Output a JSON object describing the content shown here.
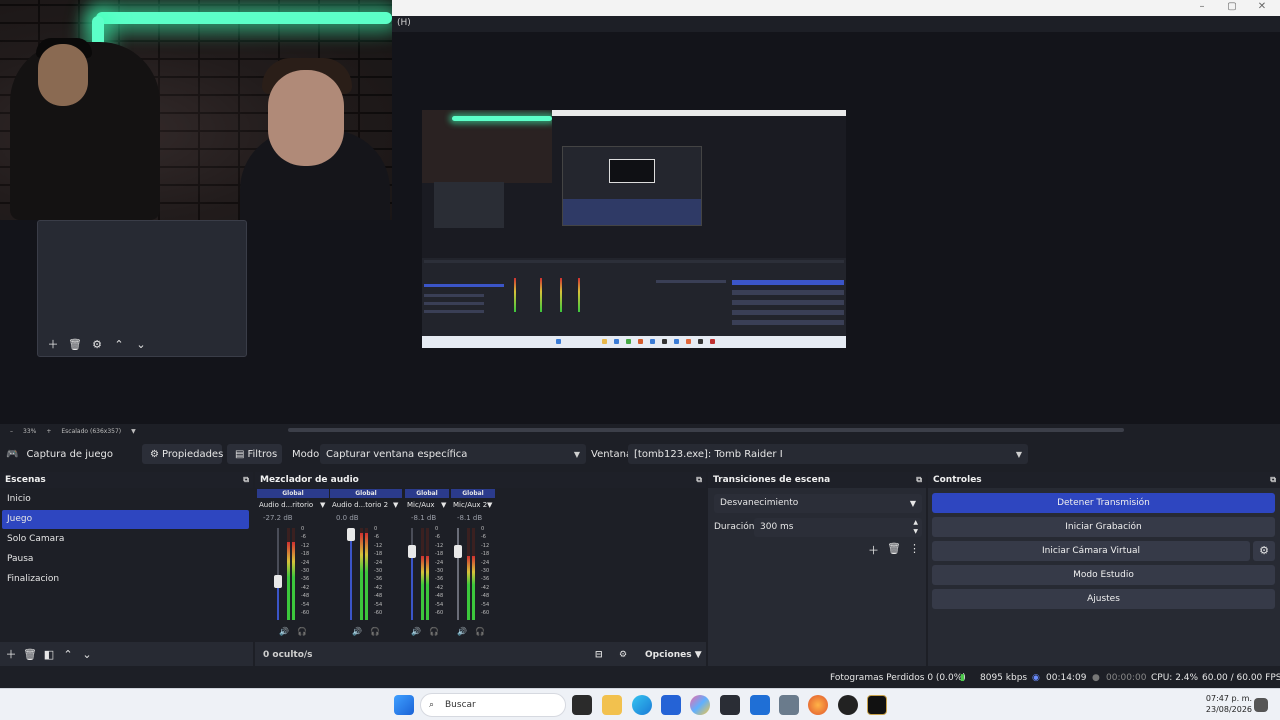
{
  "window": {
    "menu_help": "(H)",
    "minimize": "–",
    "maximize": "▢",
    "close": "✕"
  },
  "preview": {
    "zoom": "33%",
    "scale_label": "Escalado (636x357)",
    "zoom_minus": "–",
    "zoom_plus": "+"
  },
  "source_toolbar": {
    "source_name": "Captura de juego",
    "properties": "Propiedades",
    "filters": "Filtros",
    "mode_label": "Modo",
    "mode_value": "Capturar ventana específica",
    "window_label": "Ventana",
    "window_value": "[tomb123.exe]: Tomb Raider I"
  },
  "scenes": {
    "title": "Escenas",
    "items": [
      "Inicio",
      "Juego",
      "Solo Camara",
      "Pausa",
      "Finalizacion"
    ],
    "selected": "Juego"
  },
  "mixer": {
    "title": "Mezclador de audio",
    "hidden_count": "0 oculto/s",
    "options": "Opciones",
    "channels": [
      {
        "global": "Global",
        "name": "Audio d...ritorio",
        "db": "-27.2 dB",
        "volume": 0.42
      },
      {
        "global": "Global",
        "name": "Audio d...torio 2",
        "db": "0.0 dB",
        "volume": 1.0
      },
      {
        "global": "Global",
        "name": "Mic/Aux",
        "db": "-8.1 dB",
        "volume": 0.75
      },
      {
        "global": "Global",
        "name": "Mic/Aux 2",
        "db": "-8.1 dB",
        "volume": 0.75
      }
    ],
    "scale": [
      "0",
      "-6",
      "-12",
      "-18",
      "-24",
      "-30",
      "-36",
      "-42",
      "-48",
      "-54",
      "-60"
    ]
  },
  "transitions": {
    "title": "Transiciones de escena",
    "selected": "Desvanecimiento",
    "duration_label": "Duración",
    "duration_value": "300 ms"
  },
  "controls": {
    "title": "Controles",
    "stop_stream": "Detener Transmisión",
    "start_recording": "Iniciar Grabación",
    "start_virtual_cam": "Iniciar Cámara Virtual",
    "studio_mode": "Modo Estudio",
    "settings": "Ajustes"
  },
  "status": {
    "dropped_frames": "Fotogramas Perdidos 0 (0.0%)",
    "bitrate": "8095 kbps",
    "stream_time": "00:14:09",
    "rec_time": "00:00:00",
    "cpu": "CPU: 2.4%",
    "fps": "60.00 / 60.00 FPS"
  },
  "taskbar": {
    "search_placeholder": "Buscar",
    "time": "07:47 p. m.",
    "date": "23/08/2026"
  },
  "colors": {
    "accent": "#2e46c0",
    "dock_bg": "#272a33",
    "panel_bg": "#1d1f26",
    "neon": "#5cffc8"
  }
}
